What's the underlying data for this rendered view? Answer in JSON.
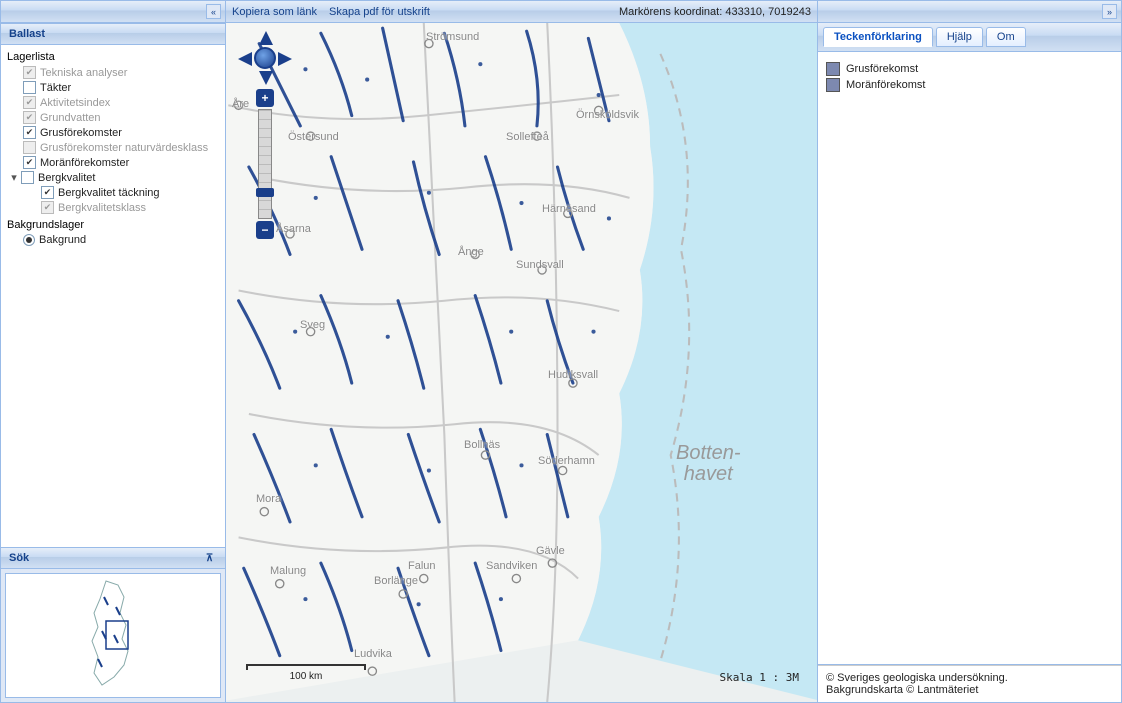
{
  "left": {
    "section_ballast": "Ballast",
    "section_sok": "Sök",
    "layer_list_heading": "Lagerlista",
    "layers": [
      {
        "label": "Tekniska analyser",
        "checked": true,
        "disabled": true,
        "indent": 1
      },
      {
        "label": "Täkter",
        "checked": false,
        "disabled": false,
        "indent": 1
      },
      {
        "label": "Aktivitetsindex",
        "checked": true,
        "disabled": true,
        "indent": 1
      },
      {
        "label": "Grundvatten",
        "checked": true,
        "disabled": true,
        "indent": 1
      },
      {
        "label": "Grusförekomster",
        "checked": true,
        "disabled": false,
        "indent": 1
      },
      {
        "label": "Grusförekomster naturvärdesklass",
        "checked": false,
        "disabled": true,
        "indent": 1
      },
      {
        "label": "Moränförekomster",
        "checked": true,
        "disabled": false,
        "indent": 1
      },
      {
        "label": "Bergkvalitet",
        "checked": false,
        "disabled": false,
        "indent": 1,
        "expandable": true
      },
      {
        "label": "Bergkvalitet täckning",
        "checked": true,
        "disabled": false,
        "indent": 2
      },
      {
        "label": "Bergkvalitetsklass",
        "checked": true,
        "disabled": true,
        "indent": 2
      }
    ],
    "background_heading": "Bakgrundslager",
    "background_radio_label": "Bakgrund"
  },
  "toolbar": {
    "link_copy": "Kopiera som länk",
    "link_pdf": "Skapa pdf för utskrift",
    "coord_label": "Markörens koordinat:",
    "coord_value": "433310, 7019243"
  },
  "map": {
    "scale_text": "Skala 1 : 3M",
    "scale_distance": "100 km",
    "sea_label_1": "Botten-",
    "sea_label_2": "havet",
    "places": {
      "stromsund": "Strömsund",
      "ornskoldsvik": "Örnsköldsvik",
      "are": "Åre",
      "ostersund": "Östersund",
      "solleftea": "Sollefteå",
      "asarna": "Åsarna",
      "ange": "Ånge",
      "harnosand": "Härnösand",
      "sundsvall": "Sundsvall",
      "sveg": "Sveg",
      "hudiksvall": "Hudiksvall",
      "bollnas": "Bollnäs",
      "soderhamn": "Söderhamn",
      "mora": "Mora",
      "falun": "Falun",
      "sandviken": "Sandviken",
      "gavle": "Gävle",
      "malung": "Malung",
      "borlange": "Borlänge",
      "ludvika": "Ludvika"
    }
  },
  "right": {
    "tab_legend": "Teckenförklaring",
    "tab_help": "Hjälp",
    "tab_about": "Om",
    "legend": [
      {
        "label": "Grusförekomst"
      },
      {
        "label": "Moränförekomst"
      }
    ],
    "credits_line1": "© Sveriges geologiska undersökning.",
    "credits_line2": "Bakgrundskarta © Lantmäteriet"
  }
}
